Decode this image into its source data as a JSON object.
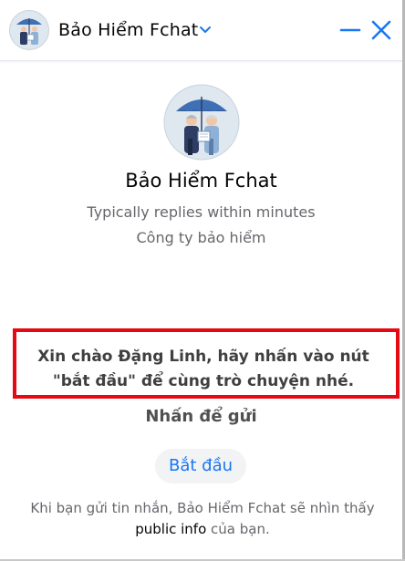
{
  "header": {
    "title": "Bảo Hiểm Fchat",
    "avatar_icon": "umbrella-couple-avatar-icon",
    "chevron_icon": "chevron-down-icon",
    "minimize_icon": "minimize-icon",
    "close_icon": "close-icon",
    "accent_color": "#1877f2"
  },
  "profile": {
    "name": "Bảo Hiểm Fchat",
    "reply_time": "Typically replies within minutes",
    "category": "Công ty bảo hiểm"
  },
  "greeting": {
    "text": "Xin chào Đặng Linh, hãy nhấn vào nút \"bắt đầu\" để cùng trò chuyện nhé.",
    "highlight_color": "#e50914"
  },
  "send_hint": "Nhấn để gửi",
  "start_button": {
    "label": "Bắt đầu"
  },
  "disclaimer": {
    "prefix": "Khi bạn gửi tin nhắn, Bảo Hiểm Fchat sẽ nhìn thấy",
    "link": "public info",
    "suffix": " của bạn."
  }
}
